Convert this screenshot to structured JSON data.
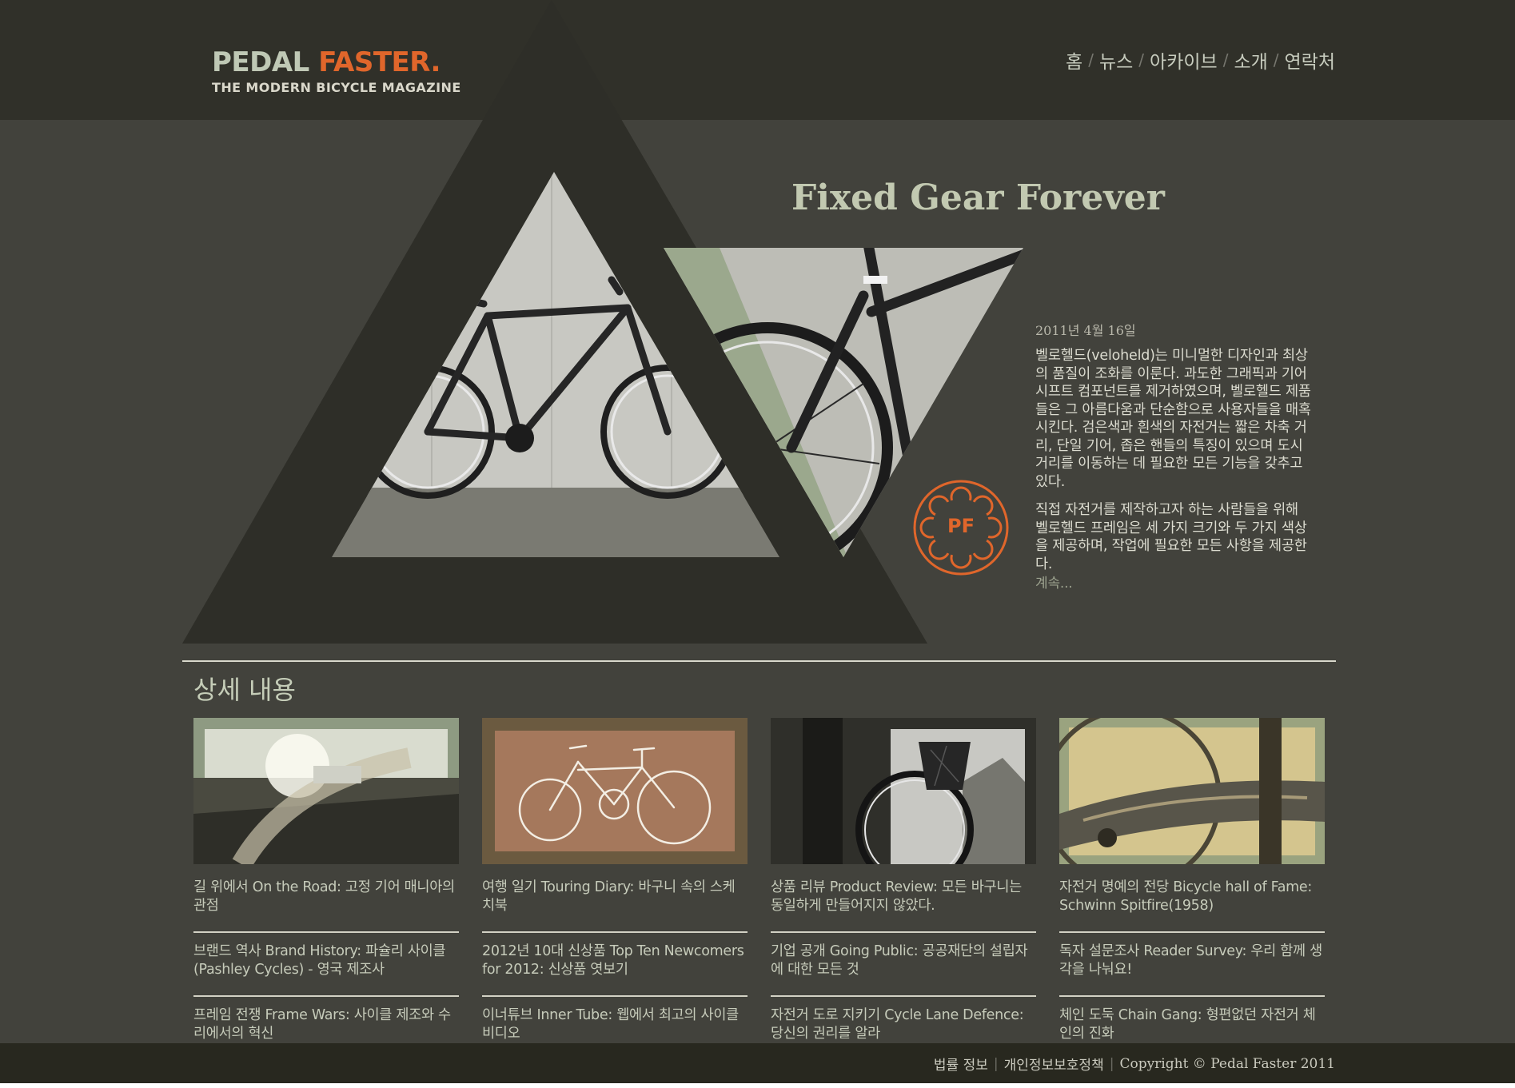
{
  "brand": {
    "name_part1": "PEDAL ",
    "name_part2": "FASTER.",
    "tagline": "THE MODERN BICYCLE MAGAZINE",
    "badge": "PF"
  },
  "nav": {
    "items": [
      "홈",
      "뉴스",
      "아카이브",
      "소개",
      "연락처"
    ],
    "separator": "/"
  },
  "hero": {
    "title": "Fixed Gear Forever",
    "date": "2011년 4월 16일",
    "paragraphs": [
      "벨로헬드(veloheld)는 미니멀한 디자인과 최상의 품질이 조화를 이룬다. 과도한 그래픽과 기어 시프트 컴포넌트를 제거하였으며, 벨로헬드 제품들은 그 아름다움과 단순함으로 사용자들을 매혹시킨다. 검은색과 흰색의 자전거는 짧은 차축 거리, 단일 기어, 좁은 핸들의 특징이 있으며 도시 거리를 이동하는 데 필요한 모든 기능을 갖추고 있다.",
      "직접 자전거를 제작하고자 하는 사람들을 위해 벨로헬드 프레임은 세 가지 크기와 두 가지 색상을 제공하며, 작업에 필요한 모든 사항을 제공한다."
    ],
    "more": "계속..."
  },
  "section": {
    "title": "상세 내용"
  },
  "columns": [
    {
      "image": "road-photo",
      "articles": [
        "길 위에서 On the Road: 고정 기어 매니아의 관점",
        "브랜드 역사 Brand History: 파슐리 사이클(Pashley Cycles) - 영국 제조사",
        "프레임 전쟁 Frame Wars: 사이클 제조와 수리에서의 혁신"
      ]
    },
    {
      "image": "bicycle-sketch",
      "articles": [
        "여행 일기 Touring Diary: 바구니 속의 스케치북",
        "2012년 10대 신상품 Top Ten Newcomers for 2012: 신상품 엿보기",
        "이너튜브 Inner Tube: 웹에서 최고의 사이클 비디오"
      ]
    },
    {
      "image": "basket-bicycle-photo",
      "articles": [
        "상품 리뷰 Product Review: 모든 바구니는 동일하게 만들어지지 않았다.",
        "기업 공개 Going Public: 공공재단의 설립자에 대한 모든 것",
        "자전거 도로 지키기 Cycle Lane Defence: 당신의 권리를 알라"
      ]
    },
    {
      "image": "spitfire-frame-photo",
      "articles": [
        "자전거 명예의 전당 Bicycle hall of Fame: Schwinn Spitfire(1958)",
        "독자 설문조사 Reader Survey: 우리 함께 생각을 나눠요!",
        "체인 도둑 Chain Gang: 형편없던 자전거 체인의 진화"
      ]
    }
  ],
  "footer": {
    "links": [
      "법률 정보",
      "개인정보보호정책"
    ],
    "copyright": "Copyright © Pedal Faster 2011"
  },
  "colors": {
    "background": "#42423c",
    "header": "#303029",
    "accent_orange": "#e0662b",
    "sage_green": "#c2c9b1"
  }
}
